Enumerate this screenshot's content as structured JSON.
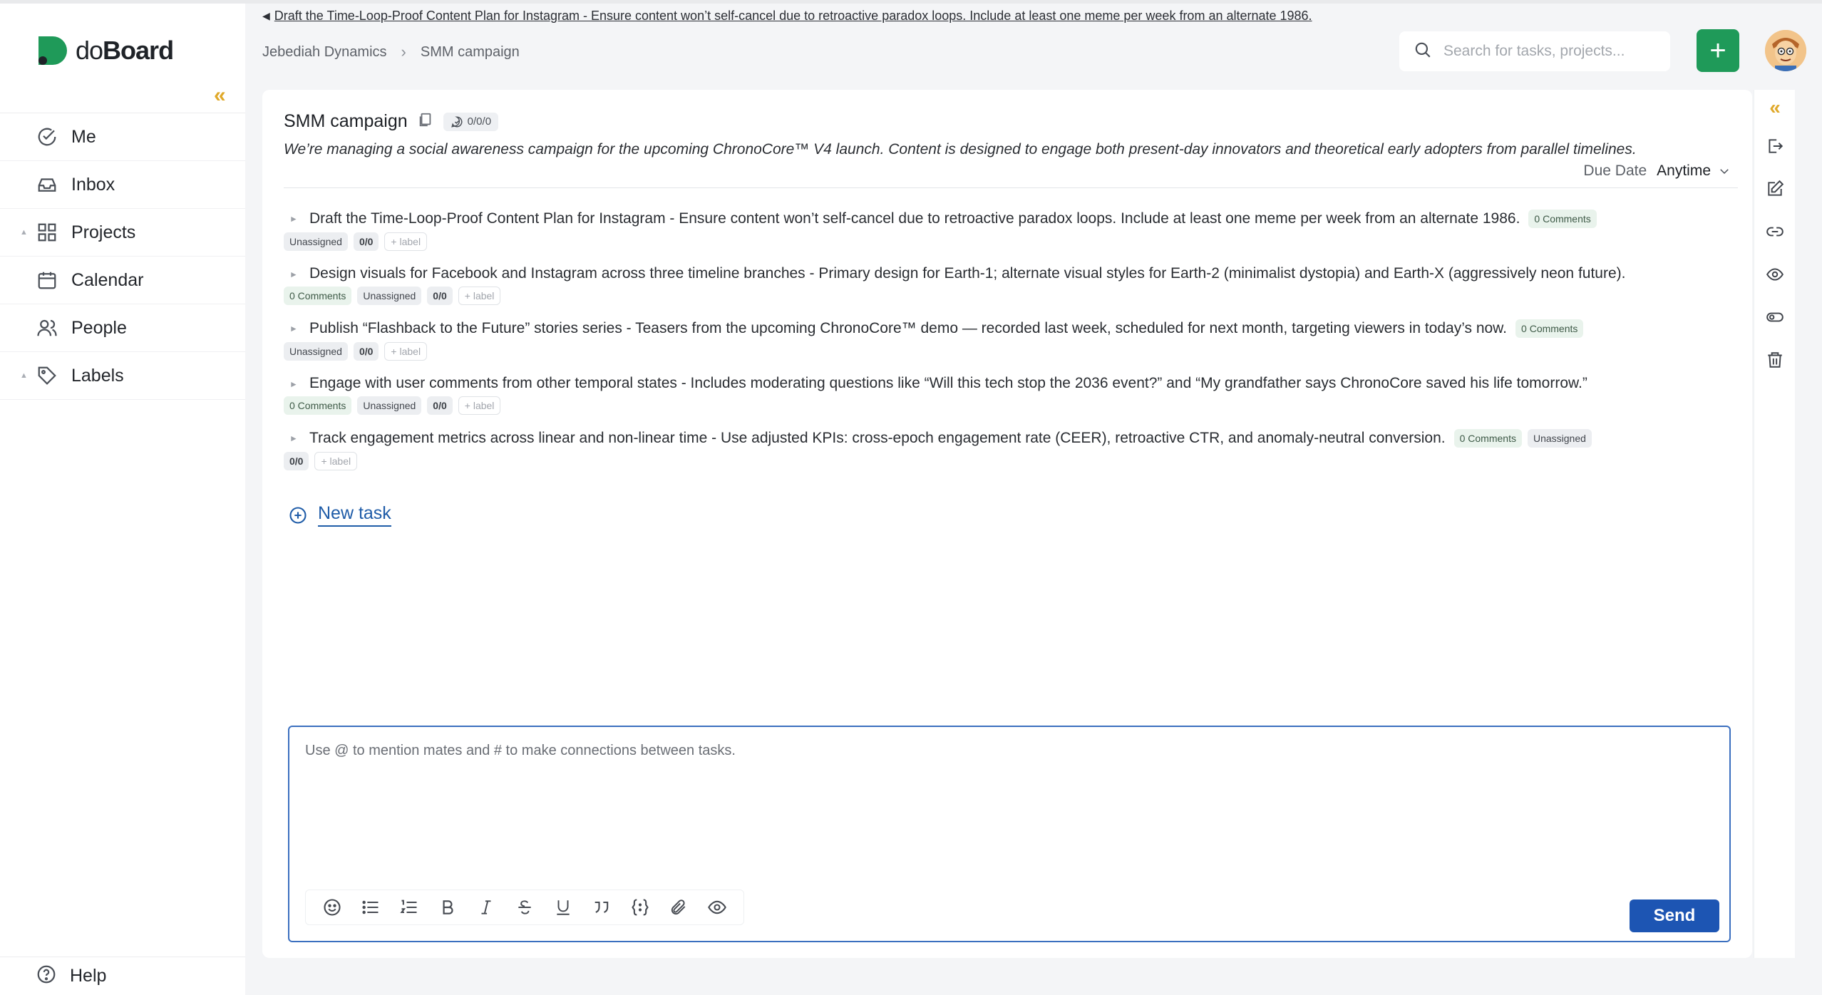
{
  "app": {
    "name_part1": "do",
    "name_part2": "Board",
    "notice": "Draft the Time-Loop-Proof Content Plan for Instagram - Ensure content won’t self-cancel due to retroactive paradox loops. Include at least one meme per week from an alternate 1986."
  },
  "sidebar": {
    "collapse_icon": "double-chevron-left-icon",
    "items": [
      {
        "label": "Me",
        "icon": "check-circle-icon"
      },
      {
        "label": "Inbox",
        "icon": "inbox-icon"
      },
      {
        "label": "Projects",
        "icon": "grid-icon"
      },
      {
        "label": "Calendar",
        "icon": "calendar-icon"
      },
      {
        "label": "People",
        "icon": "people-icon"
      },
      {
        "label": "Labels",
        "icon": "tag-icon"
      }
    ],
    "help": "Help"
  },
  "header": {
    "breadcrumb": [
      "Jebediah Dynamics",
      "SMM campaign"
    ],
    "search_placeholder": "Search for tasks, projects...",
    "add_label": "+"
  },
  "project": {
    "title": "SMM campaign",
    "counter": "0/0/0",
    "description": "We’re managing a social awareness campaign for the upcoming ChronoCore™ V4 launch. Content is designed to engage both present-day innovators and theoretical early adopters from parallel timelines.",
    "due_label": "Due Date",
    "due_value": "Anytime"
  },
  "tasks": [
    {
      "title": "Draft the Time-Loop-Proof Content Plan for Instagram - Ensure content won’t self-cancel due to retroactive paradox loops. Include at least one meme per week from an alternate 1986.",
      "comments": "0 Comments",
      "assignee": "Unassigned",
      "count": "0/0",
      "label": "+ label"
    },
    {
      "title": "Design visuals for Facebook and Instagram across three timeline branches - Primary design for Earth-1; alternate visual styles for Earth-2 (minimalist dystopia) and Earth-X (aggressively neon future).",
      "comments": "0 Comments",
      "assignee": "Unassigned",
      "count": "0/0",
      "label": "+ label"
    },
    {
      "title": "Publish “Flashback to the Future” stories series - Teasers from the upcoming ChronoCore™ demo — recorded last week, scheduled for next month, targeting viewers in today’s now.",
      "comments": "0 Comments",
      "assignee": "Unassigned",
      "count": "0/0",
      "label": "+ label"
    },
    {
      "title": "Engage with user comments from other temporal states - Includes moderating questions like “Will this tech stop the 2036 event?” and “My grandfather says ChronoCore saved his life tomorrow.”",
      "comments": "0 Comments",
      "assignee": "Unassigned",
      "count": "0/0",
      "label": "+ label"
    },
    {
      "title": "Track engagement metrics across linear and non-linear time - Use adjusted KPIs: cross-epoch engagement rate (CEER), retroactive CTR, and anomaly-neutral conversion.",
      "comments": "0 Comments",
      "assignee": "Unassigned",
      "count": "0/0",
      "label": "+ label"
    }
  ],
  "new_task": "New task",
  "comment": {
    "placeholder": "Use @ to mention mates and # to make connections between tasks.",
    "send": "Send",
    "toolbar": [
      "emoji-icon",
      "bullet-list-icon",
      "numbered-list-icon",
      "bold-icon",
      "italic-icon",
      "strikethrough-icon",
      "underline-icon",
      "quote-icon",
      "code-icon",
      "attachment-icon",
      "preview-icon"
    ]
  },
  "rail": [
    "double-chevron-left-icon",
    "export-icon",
    "edit-icon",
    "link-icon",
    "eye-icon",
    "toggle-icon",
    "trash-icon"
  ],
  "colors": {
    "accent": "#1f9a59",
    "link": "#1f5ca8",
    "send": "#1d55b3",
    "collapse": "#e0a92a"
  }
}
